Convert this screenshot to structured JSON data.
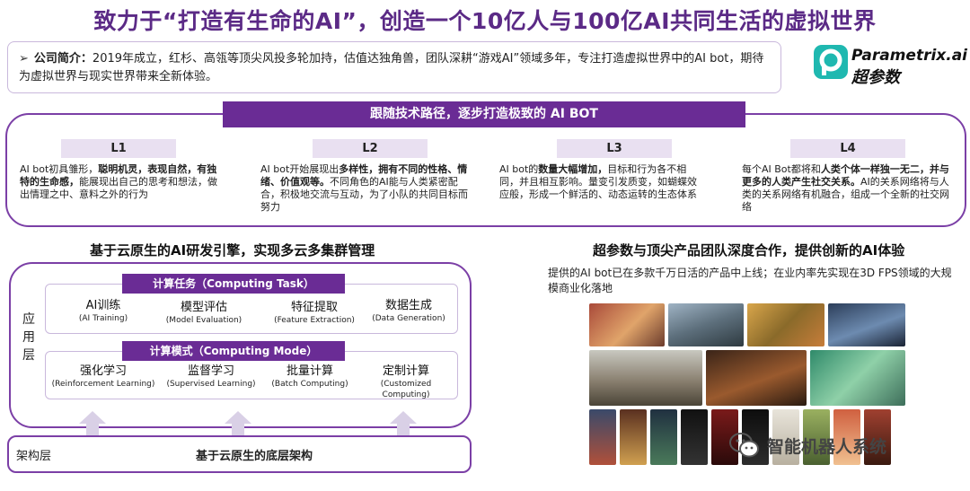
{
  "title": "致力于“打造有生命的AI”，创造一个10亿人与100亿AI共同生活的虚拟世界",
  "intro": {
    "label": "公司简介：",
    "text": "2019年成立，红杉、高瓴等顶尖风投多轮加持，估值达独角兽，团队深耕“游戏AI”领域多年，专注打造虚拟世界中的AI bot，期待为虚拟世界与现实世界带来全新体验。"
  },
  "logo": {
    "en": "Parametrix.ai",
    "cn": "超参数"
  },
  "roadmap": {
    "banner": "跟随技术路径，逐步打造极致的 AI BOT",
    "levels": [
      {
        "tag": "L1",
        "parts": [
          "AI bot初具雏形，",
          "聪明机灵，表现自然，有独特的生命感，",
          "能展现出自己的思考和想法，做出情理之中、意料之外的行为"
        ]
      },
      {
        "tag": "L2",
        "parts": [
          "AI bot开始展现出",
          "多样性，拥有不同的性格、情绪、价值观等。",
          "不同角色的AI能与人类紧密配合，积极地交流与互动，为了小队的共同目标而努力"
        ]
      },
      {
        "tag": "L3",
        "parts": [
          "AI bot的",
          "数量大幅增加，",
          "目标和行为各不相同，并且相互影响。量变引发质变，如蝴蝶效应般，形成一个鲜活的、动态运转的生态体系"
        ]
      },
      {
        "tag": "L4",
        "parts": [
          "每个AI Bot都将和",
          "人类个体一样独一无二，并与更多的人类产生社交关系。",
          "AI的关系网络将与人类的关系网络有机融合，组成一个全新的社交网络"
        ]
      }
    ]
  },
  "left_section": {
    "title": "基于云原生的AI研发引擎，实现多云多集群管理",
    "side_label": "应用层",
    "task_band": "计算任务（Computing Task）",
    "tasks": [
      {
        "cn": "AI训练",
        "en": "(AI Training)"
      },
      {
        "cn": "模型评估",
        "en": "(Model Evaluation)"
      },
      {
        "cn": "特征提取",
        "en": "(Feature Extraction)"
      },
      {
        "cn": "数据生成",
        "en": "(Data Generation)"
      }
    ],
    "mode_band": "计算模式（Computing Mode）",
    "modes": [
      {
        "cn": "强化学习",
        "en": "(Reinforcement Learning)"
      },
      {
        "cn": "监督学习",
        "en": "(Supervised Learning)"
      },
      {
        "cn": "批量计算",
        "en": "(Batch Computing)"
      },
      {
        "cn": "定制计算",
        "en": "(Customized Computing)"
      }
    ],
    "base_left": "架构层",
    "base_main": "基于云原生的底层架构"
  },
  "right_section": {
    "title": "超参数与顶尖产品团队深度合作，提供创新的AI体验",
    "text": "提供的AI bot已在多款千万日活的产品中上线；在业内率先实现在3D FPS领域的大规模商业化落地"
  },
  "watermark": {
    "text": "智能机器人系统"
  },
  "colors": {
    "brand": "#6a2c95",
    "frame": "#7b3fa6",
    "tag_bg": "#e9e0f1",
    "title": "#5b2a86"
  }
}
